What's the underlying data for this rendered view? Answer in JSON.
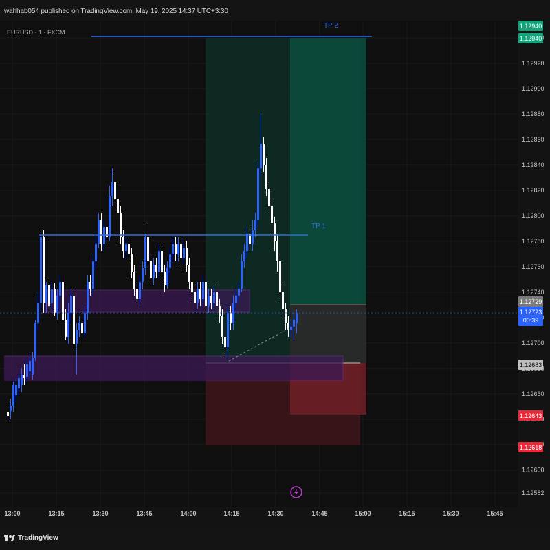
{
  "header": {
    "published_text": "wahhab054 published on TradingView.com, May 19, 2025 14:37 UTC+3:30"
  },
  "chart": {
    "symbol_label": "EURUSD · 1 · FXCM",
    "tp1_label": "TP 1",
    "tp2_label": "TP 2",
    "y_ticks": [
      "1.12940",
      "1.12920",
      "1.12900",
      "1.12880",
      "1.12860",
      "1.12840",
      "1.12820",
      "1.12800",
      "1.12780",
      "1.12760",
      "1.12740",
      "1.12720",
      "1.12700",
      "1.12680",
      "1.12660",
      "1.12640",
      "1.12620",
      "1.12600",
      "1.12582"
    ],
    "x_ticks": [
      "13:00",
      "13:15",
      "13:30",
      "13:45",
      "14:00",
      "14:15",
      "14:30",
      "14:45",
      "15:00",
      "15:15",
      "15:30",
      "15:45"
    ],
    "price_badges": [
      {
        "label": "1.12940",
        "color": "#12a37a",
        "text_color": "#ffffff"
      },
      {
        "label": "1.12940",
        "color": "#12a37a",
        "text_color": "#ffffff"
      },
      {
        "label": "1.12729",
        "color": "#7a7a7a",
        "text_color": "#ffffff"
      },
      {
        "label": "1.12723",
        "sub": "00:39",
        "color": "#2962ff",
        "text_color": "#ffffff"
      },
      {
        "label": "1.12683",
        "color": "#bfbfbf",
        "text_color": "#111111"
      },
      {
        "label": "1.12643",
        "color": "#e62a3a",
        "text_color": "#ffffff"
      },
      {
        "label": "1.12618",
        "color": "#e62a3a",
        "text_color": "#ffffff"
      }
    ],
    "colors": {
      "bull": "#2962ff",
      "bear": "#ffffff",
      "tp_line": "#2b6cf0",
      "zone_purple": "#6a2a8a",
      "profit_zone": "#0f5a48",
      "loss_zone": "#5a1a1f"
    }
  },
  "footer": {
    "logo_text": "TradingView"
  }
}
